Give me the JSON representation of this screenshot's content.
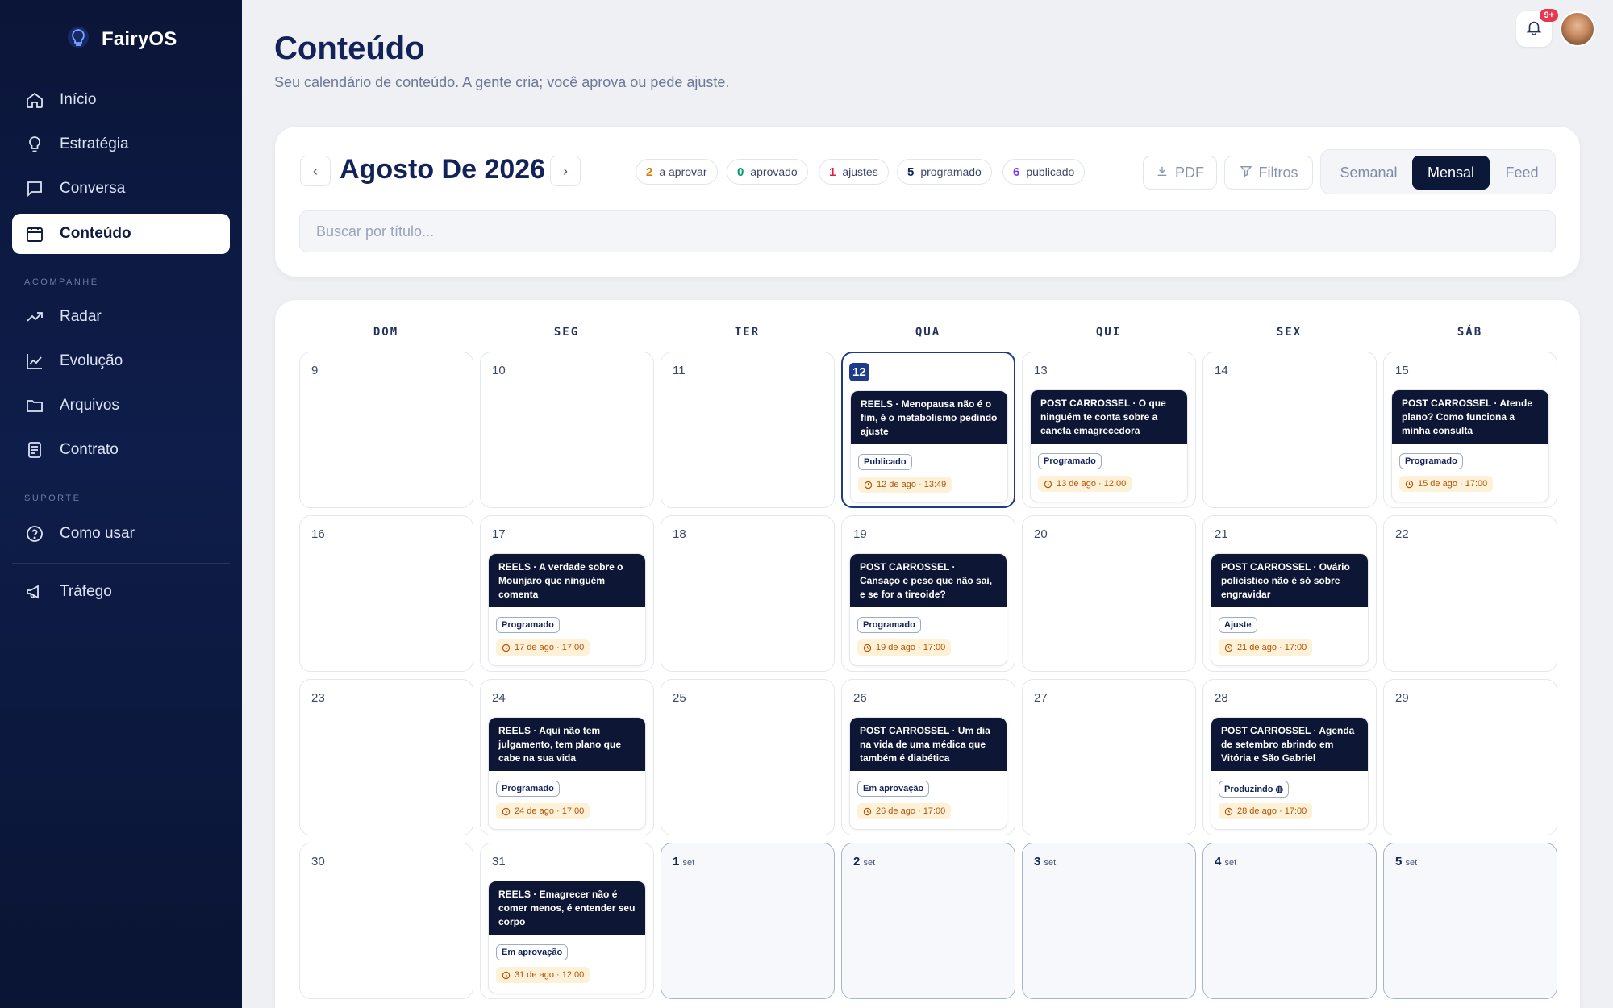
{
  "app": {
    "name": "FairyOS"
  },
  "nav": {
    "main": [
      {
        "label": "Início",
        "icon": "home-icon"
      },
      {
        "label": "Estratégia",
        "icon": "lightbulb-icon"
      },
      {
        "label": "Conversa",
        "icon": "chat-icon"
      },
      {
        "label": "Conteúdo",
        "icon": "calendar-icon"
      }
    ],
    "acompanhe_label": "ACOMPANHE",
    "acompanhe": [
      {
        "label": "Radar",
        "icon": "trending-icon"
      },
      {
        "label": "Evolução",
        "icon": "chart-icon"
      },
      {
        "label": "Arquivos",
        "icon": "folder-icon"
      },
      {
        "label": "Contrato",
        "icon": "document-icon"
      }
    ],
    "suporte_label": "SUPORTE",
    "suporte": [
      {
        "label": "Como usar",
        "icon": "help-icon"
      }
    ],
    "extra": [
      {
        "label": "Tráfego",
        "icon": "megaphone-icon"
      }
    ]
  },
  "header": {
    "title": "Conteúdo",
    "subtitle": "Seu calendário de conteúdo. A gente cria; você aprova ou pede ajuste.",
    "notifications": "9+"
  },
  "toolbar": {
    "prev": "‹",
    "next": "›",
    "month": "Agosto De 2026",
    "counts": [
      {
        "n": "2",
        "label": "a aprovar",
        "color": "#d97706"
      },
      {
        "n": "0",
        "label": "aprovado",
        "color": "#059669"
      },
      {
        "n": "1",
        "label": "ajustes",
        "color": "#e11d48"
      },
      {
        "n": "5",
        "label": "programado",
        "color": "#13235a"
      },
      {
        "n": "6",
        "label": "publicado",
        "color": "#7c3aed"
      }
    ],
    "pdf": "PDF",
    "filters": "Filtros",
    "views": [
      "Semanal",
      "Mensal",
      "Feed"
    ],
    "active_view": "Mensal",
    "search_placeholder": "Buscar por título..."
  },
  "calendar": {
    "weekdays": [
      "DOM",
      "SEG",
      "TER",
      "QUA",
      "QUI",
      "SEX",
      "SÁB"
    ],
    "weeks": [
      [
        {
          "d": "9"
        },
        {
          "d": "10"
        },
        {
          "d": "11"
        },
        {
          "d": "12",
          "today": true,
          "post": {
            "title": "REELS · Menopausa não é o fim, é o metabolismo pedindo ajuste",
            "status": "Publicado",
            "when": "12 de ago · 13:49"
          }
        },
        {
          "d": "13",
          "post": {
            "title": "POST CARROSSEL · O que ninguém te conta sobre a caneta emagrecedora",
            "status": "Programado",
            "when": "13 de ago · 12:00"
          }
        },
        {
          "d": "14"
        },
        {
          "d": "15",
          "post": {
            "title": "POST CARROSSEL · Atende plano? Como funciona a minha consulta",
            "status": "Programado",
            "when": "15 de ago · 17:00"
          }
        }
      ],
      [
        {
          "d": "16"
        },
        {
          "d": "17",
          "post": {
            "title": "REELS · A verdade sobre o Mounjaro que ninguém comenta",
            "status": "Programado",
            "when": "17 de ago · 17:00"
          }
        },
        {
          "d": "18"
        },
        {
          "d": "19",
          "post": {
            "title": "POST CARROSSEL · Cansaço e peso que não sai, e se for a tireoide?",
            "status": "Programado",
            "when": "19 de ago · 17:00"
          }
        },
        {
          "d": "20"
        },
        {
          "d": "21",
          "post": {
            "title": "POST CARROSSEL · Ovário policístico não é só sobre engravidar",
            "status": "Ajuste",
            "when": "21 de ago · 17:00"
          }
        },
        {
          "d": "22"
        }
      ],
      [
        {
          "d": "23"
        },
        {
          "d": "24",
          "post": {
            "title": "REELS · Aqui não tem julgamento, tem plano que cabe na sua vida",
            "status": "Programado",
            "when": "24 de ago · 17:00"
          }
        },
        {
          "d": "25"
        },
        {
          "d": "26",
          "post": {
            "title": "POST CARROSSEL · Um dia na vida de uma médica que também é diabética",
            "status": "Em aprovação",
            "when": "26 de ago · 17:00"
          }
        },
        {
          "d": "27"
        },
        {
          "d": "28",
          "post": {
            "title": "POST CARROSSEL · Agenda de setembro abrindo em Vitória e São Gabriel",
            "status": "Produzindo ◍",
            "when": "28 de ago · 17:00"
          }
        },
        {
          "d": "29"
        }
      ],
      [
        {
          "d": "30"
        },
        {
          "d": "31",
          "post": {
            "title": "REELS · Emagrecer não é comer menos, é entender seu corpo",
            "status": "Em aprovação",
            "when": "31 de ago · 12:00"
          }
        },
        {
          "d": "1",
          "sub": "set",
          "next": true
        },
        {
          "d": "2",
          "sub": "set",
          "next": true
        },
        {
          "d": "3",
          "sub": "set",
          "next": true
        },
        {
          "d": "4",
          "sub": "set",
          "next": true
        },
        {
          "d": "5",
          "sub": "set",
          "next": true
        }
      ]
    ]
  }
}
